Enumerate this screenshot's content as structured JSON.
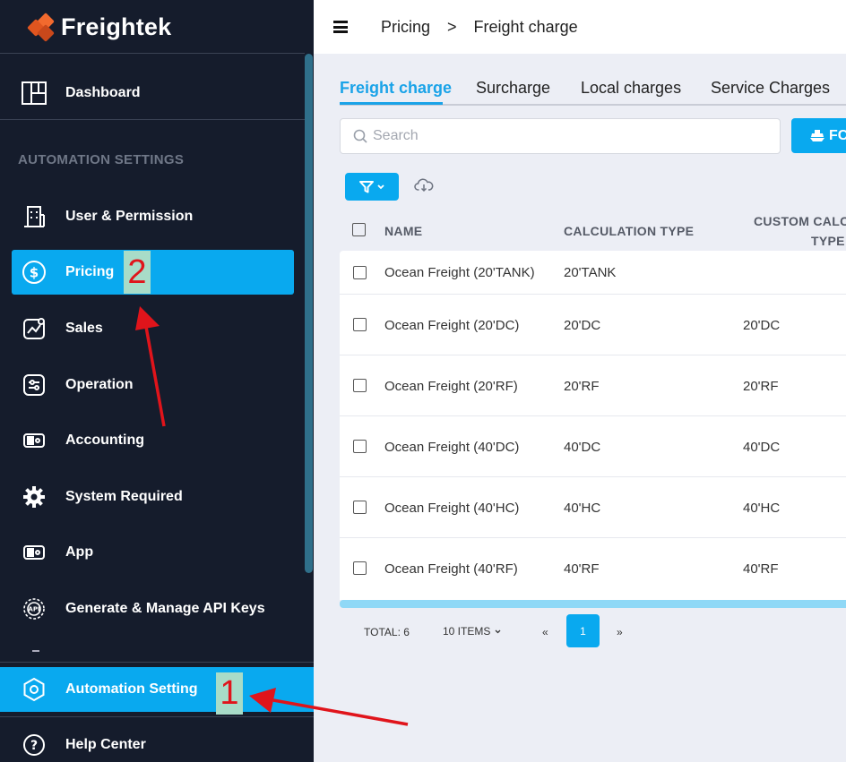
{
  "app": {
    "name": "Freightek"
  },
  "sidebar": {
    "dashboard": "Dashboard",
    "section_title": "AUTOMATION SETTINGS",
    "items": [
      {
        "label": "User & Permission",
        "icon": "building-icon"
      },
      {
        "label": "Pricing",
        "icon": "dollar-circle-icon"
      },
      {
        "label": "Sales",
        "icon": "chart-icon"
      },
      {
        "label": "Operation",
        "icon": "sliders-icon"
      },
      {
        "label": "Accounting",
        "icon": "cash-icon"
      },
      {
        "label": "System Required",
        "icon": "gear-icon"
      },
      {
        "label": "App",
        "icon": "cash-icon"
      },
      {
        "label": "Generate & Manage API Keys",
        "icon": "api-gear-icon"
      }
    ],
    "automation_setting": "Automation Setting",
    "help_center": "Help Center"
  },
  "header": {
    "breadcrumb_1": "Pricing",
    "separator": ">",
    "breadcrumb_2": "Freight charge"
  },
  "tabs": [
    "Freight charge",
    "Surcharge",
    "Local charges",
    "Service Charges"
  ],
  "search": {
    "placeholder": "Search"
  },
  "fcl_button": "FC",
  "table": {
    "headers": {
      "name": "NAME",
      "calc_type": "CALCULATION TYPE",
      "custom_line1": "CUSTOM CALCU",
      "custom_line2": "TYPE"
    },
    "rows": [
      {
        "name": "Ocean Freight (20'TANK)",
        "calc": "20'TANK",
        "custom": ""
      },
      {
        "name": "Ocean Freight (20'DC)",
        "calc": "20'DC",
        "custom": "20'DC"
      },
      {
        "name": "Ocean Freight (20'RF)",
        "calc": "20'RF",
        "custom": "20'RF"
      },
      {
        "name": "Ocean Freight (40'DC)",
        "calc": "40'DC",
        "custom": "40'DC"
      },
      {
        "name": "Ocean Freight (40'HC)",
        "calc": "40'HC",
        "custom": "40'HC"
      },
      {
        "name": "Ocean Freight (40'RF)",
        "calc": "40'RF",
        "custom": "40'RF"
      }
    ]
  },
  "pagination": {
    "total": "TOTAL: 6",
    "items": "10 ITEMS",
    "prev": "«",
    "page": "1",
    "next": "»"
  },
  "annotations": {
    "label_1": "1",
    "label_2": "2",
    "color": "#e0141b"
  },
  "colors": {
    "accent": "#09a9ef",
    "sidebar": "#151c2c",
    "brand": "#f26a2e"
  }
}
